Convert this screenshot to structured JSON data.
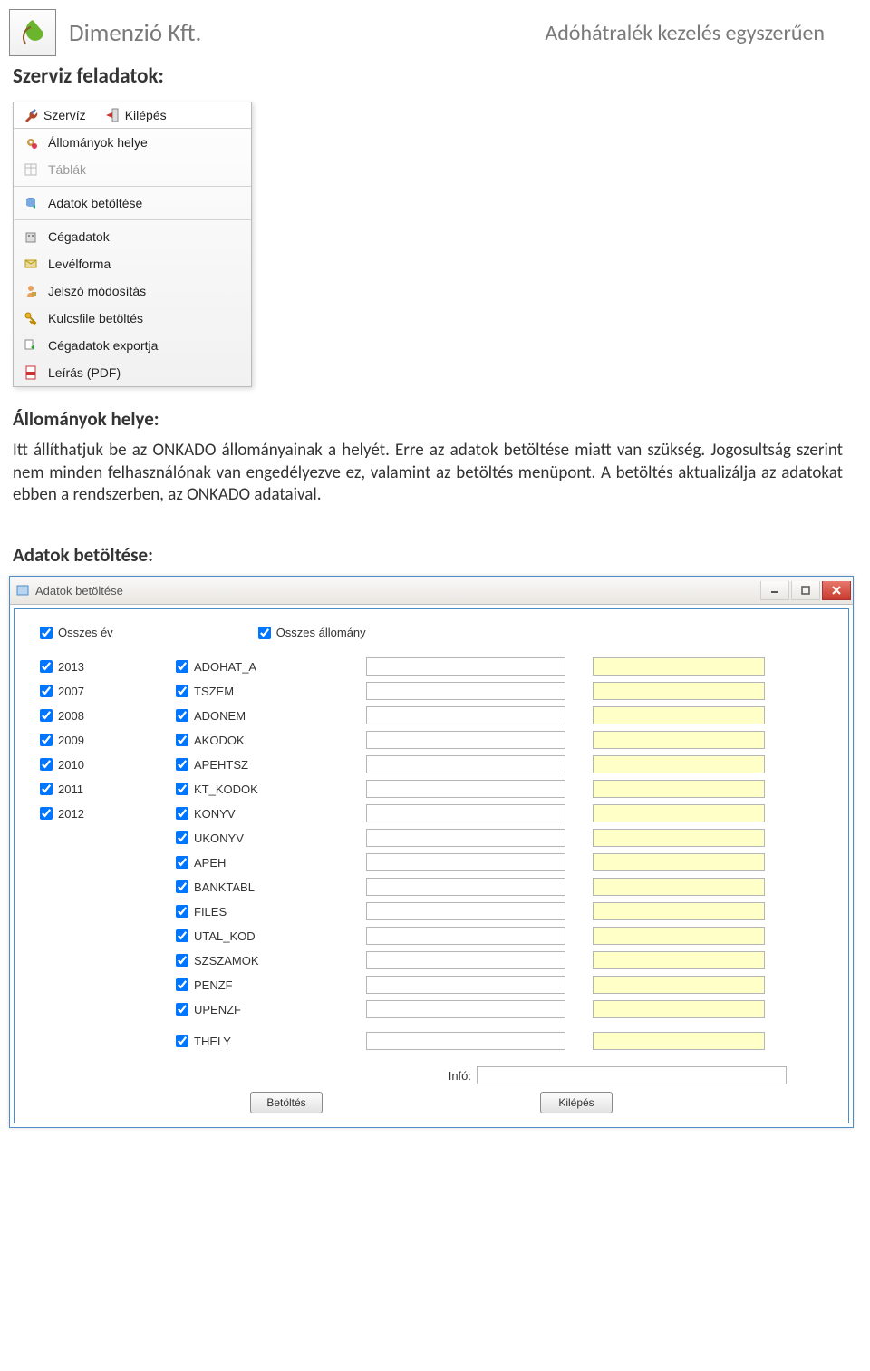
{
  "header": {
    "company": "Dimenzió Kft.",
    "tagline": "Adóhátralék kezelés egyszerűen"
  },
  "section1_title": "Szerviz feladatok:",
  "menu": {
    "bar": [
      {
        "label": "Szervíz",
        "icon": "wrench-icon"
      },
      {
        "label": "Kilépés",
        "icon": "exit-icon"
      }
    ],
    "items": [
      {
        "label": "Állományok helye",
        "icon": "gear-icon",
        "disabled": false
      },
      {
        "label": "Táblák",
        "icon": "table-icon",
        "disabled": true
      },
      {
        "label": "Adatok betöltése",
        "icon": "db-refresh-icon",
        "disabled": false
      },
      {
        "label": "Cégadatok",
        "icon": "company-icon",
        "disabled": false
      },
      {
        "label": "Levélforma",
        "icon": "mail-icon",
        "disabled": false
      },
      {
        "label": "Jelszó módosítás",
        "icon": "password-icon",
        "disabled": false
      },
      {
        "label": "Kulcsfile betöltés",
        "icon": "key-icon",
        "disabled": false
      },
      {
        "label": "Cégadatok exportja",
        "icon": "export-icon",
        "disabled": false
      },
      {
        "label": "Leírás (PDF)",
        "icon": "pdf-icon",
        "disabled": false
      }
    ]
  },
  "section2_title": "Állományok helye:",
  "paragraph": "Itt állíthatjuk be az ONKADO állományainak a helyét. Erre az adatok betöltése miatt van szükség. Jogosultság szerint nem minden felhasználónak van engedélyezve ez, valamint az betöltés menüpont. A betöltés aktualizálja az adatokat ebben a rendszerben, az ONKADO adataival.",
  "section3_title": "Adatok betöltése:",
  "window": {
    "title": "Adatok betöltése",
    "master_year": "Összes év",
    "master_file": "Összes állomány",
    "years": [
      "2013",
      "2007",
      "2008",
      "2009",
      "2010",
      "2011",
      "2012"
    ],
    "files": [
      "ADOHAT_A",
      "TSZEM",
      "ADONEM",
      "AKODOK",
      "APEHTSZ",
      "KT_KODOK",
      "KONYV",
      "UKONYV",
      "APEH",
      "BANKTABL",
      "FILES",
      "UTAL_KOD",
      "SZSZAMOK",
      "PENZF",
      "UPENZF",
      "THELY"
    ],
    "info_label": "Infó:",
    "btn_load": "Betöltés",
    "btn_exit": "Kilépés"
  }
}
